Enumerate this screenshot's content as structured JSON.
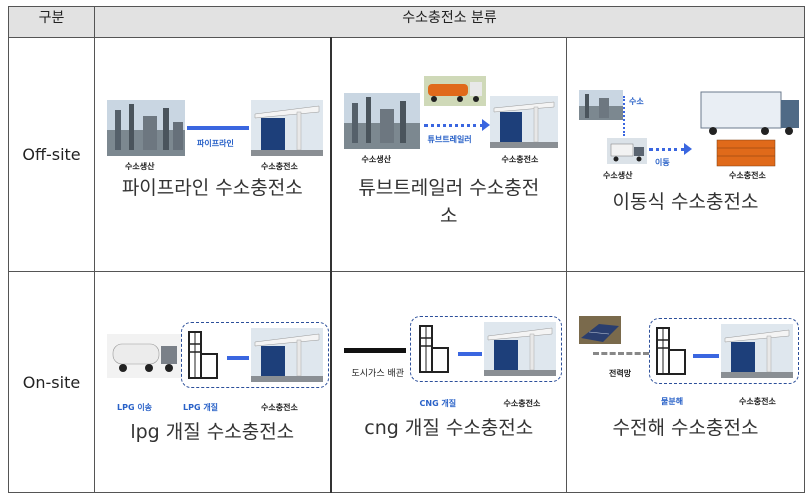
{
  "header": {
    "col1": "구분",
    "col2": "수소충전소 분류"
  },
  "rows": [
    {
      "label": "Off-site",
      "cells": [
        {
          "caption": "파이프라인 수소충전소",
          "tags": [
            "파이프라인",
            "수소생산",
            "수소충전소"
          ]
        },
        {
          "caption_line1": "튜브트레일러 수소충전",
          "caption_line2": "소",
          "tags": [
            "튜브트레일러",
            "수소생산",
            "수소충전소"
          ]
        },
        {
          "caption": "이동식 수소충전소",
          "tags": [
            "수소",
            "이동",
            "수소생산",
            "수소충전소"
          ]
        }
      ]
    },
    {
      "label": "On-site",
      "cells": [
        {
          "caption": "lpg 개질 수소충전소",
          "tags": [
            "LPG 이송",
            "LPG 개질",
            "수소충전소"
          ]
        },
        {
          "caption": "cng 개질 수소충전소",
          "tags": [
            "도시가스 배관",
            "CNG 개질",
            "수소충전소"
          ]
        },
        {
          "caption": "수전해 수소충전소",
          "tags": [
            "전력망",
            "물분해",
            "수소충전소"
          ]
        }
      ]
    }
  ]
}
